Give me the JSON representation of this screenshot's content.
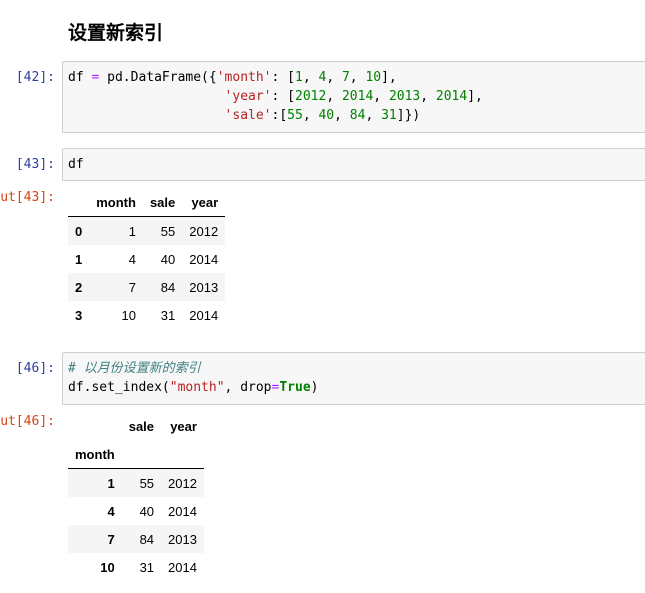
{
  "heading": "设置新索引",
  "cells": {
    "c42": {
      "prompt": "[42]:",
      "line1": {
        "a": "df ",
        "eq": "=",
        "b": " pd.DataFrame({",
        "key": "'month'",
        "c": ": [",
        "v1": "1",
        "sep1": ", ",
        "v2": "4",
        "sep2": ", ",
        "v3": "7",
        "sep3": ", ",
        "v4": "10",
        "end": "],"
      },
      "line2": {
        "pad": "                    ",
        "key": "'year'",
        "c": ": [",
        "v1": "2012",
        "sep1": ", ",
        "v2": "2014",
        "sep2": ", ",
        "v3": "2013",
        "sep3": ", ",
        "v4": "2014",
        "end": "],"
      },
      "line3": {
        "pad": "                    ",
        "key": "'sale'",
        "c": ":[",
        "v1": "55",
        "sep1": ", ",
        "v2": "40",
        "sep2": ", ",
        "v3": "84",
        "sep3": ", ",
        "v4": "31",
        "end": "]})"
      }
    },
    "c43": {
      "prompt": "[43]:",
      "code": "df",
      "out_prompt": "ut[43]:",
      "table": {
        "columns": [
          "month",
          "sale",
          "year"
        ],
        "rows": [
          {
            "idx": "0",
            "month": "1",
            "sale": "55",
            "year": "2012"
          },
          {
            "idx": "1",
            "month": "4",
            "sale": "40",
            "year": "2014"
          },
          {
            "idx": "2",
            "month": "7",
            "sale": "84",
            "year": "2013"
          },
          {
            "idx": "3",
            "month": "10",
            "sale": "31",
            "year": "2014"
          }
        ]
      }
    },
    "c46": {
      "prompt": "[46]:",
      "comment": "# 以月份设置新的索引",
      "line2": {
        "a": "df.set_index(",
        "str": "\"month\"",
        "b": ", drop",
        "eq": "=",
        "kw": "True",
        "end": ")"
      },
      "out_prompt": "ut[46]:",
      "table": {
        "columns": [
          "sale",
          "year"
        ],
        "index_name": "month",
        "rows": [
          {
            "idx": "1",
            "sale": "55",
            "year": "2012"
          },
          {
            "idx": "4",
            "sale": "40",
            "year": "2014"
          },
          {
            "idx": "7",
            "sale": "84",
            "year": "2013"
          },
          {
            "idx": "10",
            "sale": "31",
            "year": "2014"
          }
        ]
      }
    }
  }
}
